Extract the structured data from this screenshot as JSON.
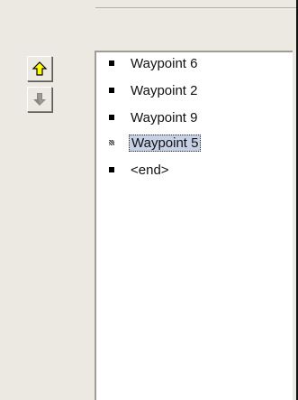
{
  "toolbar": {
    "move_up_icon": "arrow-up",
    "move_down_icon": "arrow-down"
  },
  "waypoints": {
    "items": [
      {
        "label": "Waypoint 6"
      },
      {
        "label": "Waypoint 2"
      },
      {
        "label": "Waypoint 9"
      },
      {
        "label": "Waypoint 5",
        "selected": true
      },
      {
        "label": "<end>"
      }
    ]
  },
  "colors": {
    "panel_bg": "#ece9e3",
    "list_bg": "#ffffff",
    "selection_bg": "#c7d1e6",
    "up_arrow_fill": "#ffff00",
    "down_arrow_disabled": "#8a877f"
  }
}
